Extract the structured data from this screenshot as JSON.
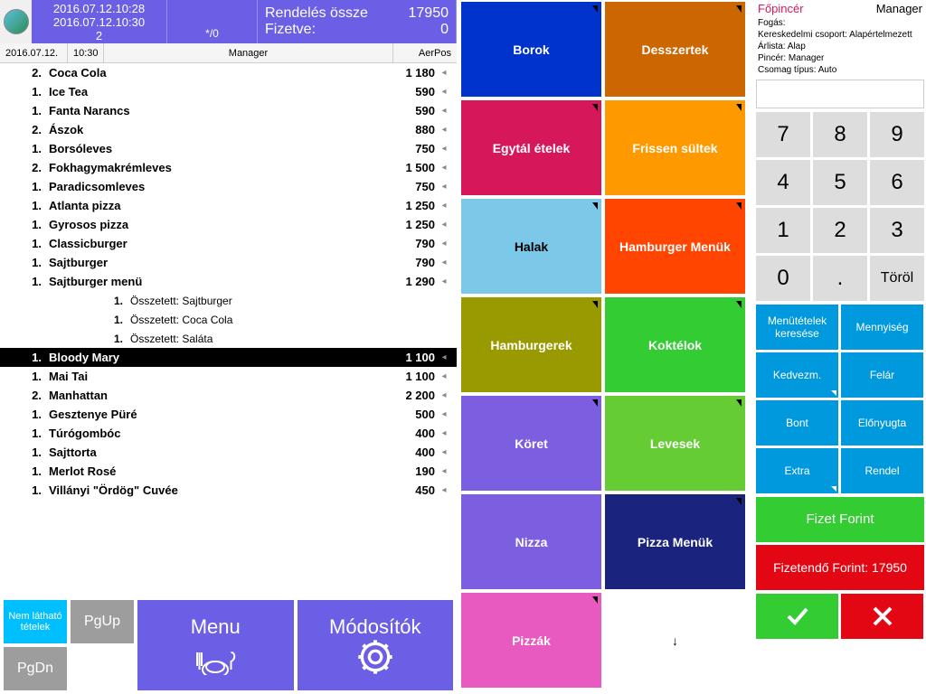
{
  "header": {
    "timestamp1": "2016.07.12.10:28",
    "timestamp2": "2016.07.12.10:30",
    "tableNum": "2",
    "subInfo": "*/0",
    "totalLabel": "Rendelés össze",
    "totalValue": "17950",
    "paidLabel": "Fizetve:",
    "paidValue": "0"
  },
  "infoBar": {
    "date": "2016.07.12.",
    "time": "10:30",
    "user": "Manager",
    "system": "AerPos"
  },
  "role": {
    "title": "Főpincér",
    "role": "Manager",
    "line1": "Fogás:",
    "line2": "Kereskedelmi csoport: Alapértelmezett",
    "line3": "Árlista: Alap",
    "line4": "Pincér: Manager",
    "line5": "Csomag típus: Auto"
  },
  "orders": [
    {
      "qty": "2.",
      "name": "Coca Cola",
      "price": "1 180"
    },
    {
      "qty": "1.",
      "name": "Ice Tea",
      "price": "590"
    },
    {
      "qty": "1.",
      "name": "Fanta Narancs",
      "price": "590"
    },
    {
      "qty": "2.",
      "name": "Ászok",
      "price": "880"
    },
    {
      "qty": "1.",
      "name": "Borsóleves",
      "price": "750"
    },
    {
      "qty": "2.",
      "name": "Fokhagymakrémleves",
      "price": "1 500"
    },
    {
      "qty": "1.",
      "name": "Paradicsomleves",
      "price": "750"
    },
    {
      "qty": "1.",
      "name": "Atlanta pizza",
      "price": "1 250"
    },
    {
      "qty": "1.",
      "name": "Gyrosos pizza",
      "price": "1 250"
    },
    {
      "qty": "1.",
      "name": "Classicburger",
      "price": "790"
    },
    {
      "qty": "1.",
      "name": "Sajtburger",
      "price": "790"
    },
    {
      "qty": "1.",
      "name": "Sajtburger menü",
      "price": "1 290"
    },
    {
      "qty": "1.",
      "name": "Összetett: Sajtburger",
      "price": "",
      "sub": true
    },
    {
      "qty": "1.",
      "name": "Összetett: Coca Cola",
      "price": "",
      "sub": true
    },
    {
      "qty": "1.",
      "name": "Összetett: Saláta",
      "price": "",
      "sub": true
    },
    {
      "qty": "1.",
      "name": "Bloody Mary",
      "price": "1 100",
      "selected": true
    },
    {
      "qty": "1.",
      "name": "Mai Tai",
      "price": "1 100"
    },
    {
      "qty": "2.",
      "name": "Manhattan",
      "price": "2 200"
    },
    {
      "qty": "1.",
      "name": "Gesztenye Püré",
      "price": "500"
    },
    {
      "qty": "1.",
      "name": "Túrógombóc",
      "price": "400"
    },
    {
      "qty": "1.",
      "name": "Sajttorta",
      "price": "400"
    },
    {
      "qty": "1.",
      "name": "Merlot Rosé",
      "price": "190"
    },
    {
      "qty": "1.",
      "name": "Villányi \"Ördög\" Cuvée",
      "price": "450"
    }
  ],
  "bottomButtons": {
    "hidden": "Nem látható tételek",
    "pgup": "PgUp",
    "pgdn": "PgDn",
    "menu": "Menu",
    "modifiers": "Módosítók"
  },
  "categories": [
    {
      "label": "Borok",
      "color": "#0033CC",
      "tri": true
    },
    {
      "label": "Desszertek",
      "color": "#CC6600",
      "tri": true
    },
    {
      "label": "Egytál ételek",
      "color": "#D6185B",
      "tri": true
    },
    {
      "label": "Frissen sültek",
      "color": "#FF9900",
      "tri": true
    },
    {
      "label": "Halak",
      "color": "#7BC8E8",
      "tri": true,
      "dark": true
    },
    {
      "label": "Hamburger Menük",
      "color": "#FF4500",
      "tri": true
    },
    {
      "label": "Hamburgerek",
      "color": "#999900",
      "tri": true
    },
    {
      "label": "Koktélok",
      "color": "#33CC33",
      "tri": true
    },
    {
      "label": "Köret",
      "color": "#7B5FE0",
      "tri": true
    },
    {
      "label": "Levesek",
      "color": "#66CC33",
      "tri": true
    },
    {
      "label": "Nizza",
      "color": "#7B5FE0",
      "tri": false
    },
    {
      "label": "Pizza Menük",
      "color": "#1A237E",
      "tri": true
    },
    {
      "label": "Pizzák",
      "color": "#E85AC0",
      "tri": true
    },
    {
      "label": "↓",
      "color": "#FFFFFF",
      "tri": false,
      "dark": true
    }
  ],
  "numpad": [
    "7",
    "8",
    "9",
    "4",
    "5",
    "6",
    "1",
    "2",
    "3",
    "0",
    "."
  ],
  "numpadDel": "Töröl",
  "actions": [
    {
      "label": "Menütételek keresése",
      "color": "#0099DD"
    },
    {
      "label": "Mennyiség",
      "color": "#0099DD"
    },
    {
      "label": "Kedvezm.",
      "color": "#0099DD",
      "tri": true
    },
    {
      "label": "Felár",
      "color": "#0099DD"
    },
    {
      "label": "Bont",
      "color": "#0099DD"
    },
    {
      "label": "Előnyugta",
      "color": "#0099DD"
    },
    {
      "label": "Extra",
      "color": "#0099DD",
      "tri": true
    },
    {
      "label": "Rendel",
      "color": "#0099DD"
    }
  ],
  "payButton": "Fizet Forint",
  "dueButton": "Fizetendő Forint: 17950"
}
